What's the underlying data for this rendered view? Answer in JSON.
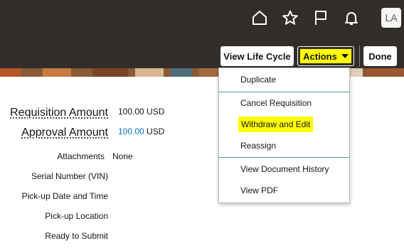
{
  "header": {
    "avatar_initials": "LA",
    "icons": [
      "home-icon",
      "favorites-star-icon",
      "watchlist-flag-icon",
      "notifications-bell-icon"
    ]
  },
  "toolbar": {
    "view_life_cycle": "View Life Cycle",
    "actions": "Actions",
    "done": "Done"
  },
  "actions_menu": {
    "items": [
      {
        "label": "Duplicate"
      },
      {
        "label": "Cancel Requisition"
      },
      {
        "label": "Withdraw and Edit",
        "highlighted": true
      },
      {
        "label": "Reassign"
      },
      {
        "label": "View Document History"
      },
      {
        "label": "View PDF"
      }
    ]
  },
  "form": {
    "requisition_amount": {
      "label": "Requisition Amount",
      "value": "100.00",
      "currency": "USD"
    },
    "approval_amount": {
      "label": "Approval Amount",
      "value": "100.00",
      "currency": "USD"
    },
    "attachments": {
      "label": "Attachments",
      "value": "None"
    },
    "serial_number": {
      "label": "Serial Number (VIN)",
      "value": ""
    },
    "pickup_date": {
      "label": "Pick-up Date and Time",
      "value": ""
    },
    "pickup_location": {
      "label": "Pick-up Location",
      "value": ""
    },
    "ready_to_submit": {
      "label": "Ready to Submit",
      "value": ""
    }
  },
  "colors": {
    "header_bg": "#312d2a",
    "highlight": "#ffff00",
    "link": "#0572ce"
  }
}
